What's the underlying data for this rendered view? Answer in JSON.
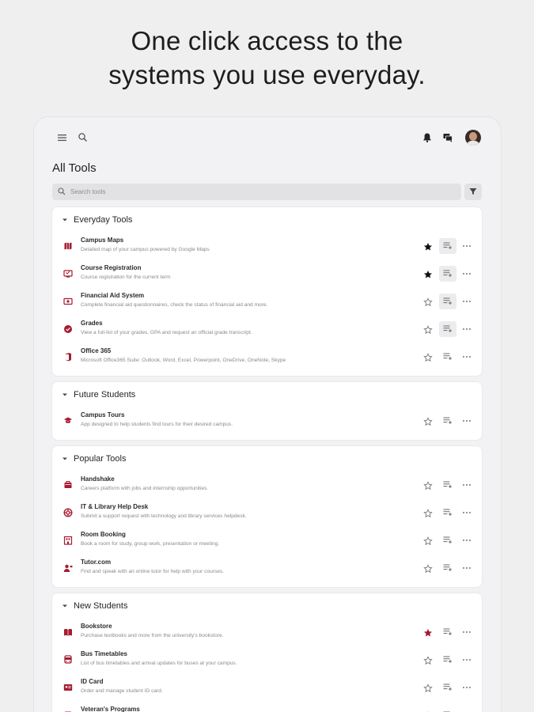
{
  "headline": {
    "line1": "One click access to the",
    "line2": "systems you use everyday."
  },
  "topbar": {
    "icons": [
      "menu-icon",
      "search-icon",
      "notification-bell-icon",
      "chat-icon",
      "avatar"
    ]
  },
  "page": {
    "title": "All Tools",
    "search_placeholder": "Search tools"
  },
  "colors": {
    "accent": "#a51c30",
    "star_filled": "#111111",
    "star_filled_accent": "#a51c30",
    "muted": "#8a8a8a"
  },
  "sections": [
    {
      "title": "Everyday Tools",
      "items": [
        {
          "name": "Campus Maps",
          "desc": "Detailed map of your campus powered by Google Maps",
          "icon": "map-icon",
          "starred": true,
          "star_color": "#111111",
          "quick_access": true
        },
        {
          "name": "Course Registration",
          "desc": "Course registration for the current term",
          "icon": "course-icon",
          "starred": true,
          "star_color": "#111111",
          "quick_access": true
        },
        {
          "name": "Financial Aid System",
          "desc": "Complete financial aid questionnaires, check the status of financial aid and more.",
          "icon": "financial-aid-icon",
          "starred": false,
          "quick_access": true
        },
        {
          "name": "Grades",
          "desc": "View a full-list of your grades, GPA and request an official grade transcript.",
          "icon": "grades-icon",
          "starred": false,
          "quick_access": true
        },
        {
          "name": "Office 365",
          "desc": "Microsoft Office365 Suite: Outlook, Word, Excel, Powerpoint, OneDrive, OneNote, Skype",
          "icon": "office-icon",
          "starred": false,
          "quick_access": false
        }
      ]
    },
    {
      "title": "Future Students",
      "items": [
        {
          "name": "Campus Tours",
          "desc": "App designed to help students find tours for their desired campus.",
          "icon": "tours-icon",
          "starred": false,
          "quick_access": false
        }
      ]
    },
    {
      "title": "Popular Tools",
      "items": [
        {
          "name": "Handshake",
          "desc": "Careers platform with jobs and internship opportunities.",
          "icon": "handshake-icon",
          "starred": false,
          "quick_access": false
        },
        {
          "name": "IT & Library Help Desk",
          "desc": "Submit a support request with technology and library services helpdesk.",
          "icon": "helpdesk-icon",
          "starred": false,
          "quick_access": false
        },
        {
          "name": "Room Booking",
          "desc": "Book a room for study, group work, presentation or meeting.",
          "icon": "room-icon",
          "starred": false,
          "quick_access": false
        },
        {
          "name": "Tutor.com",
          "desc": "Find and speak with an online tutor for help with your courses.",
          "icon": "tutor-icon",
          "starred": false,
          "quick_access": false
        }
      ]
    },
    {
      "title": "New Students",
      "items": [
        {
          "name": "Bookstore",
          "desc": "Purchase textbooks and more from the university's bookstore.",
          "icon": "bookstore-icon",
          "starred": true,
          "star_color": "#a51c30",
          "quick_access": false
        },
        {
          "name": "Bus Timetables",
          "desc": "List of bus timetables and arrival updates for buses at your campus.",
          "icon": "bus-icon",
          "starred": false,
          "quick_access": false
        },
        {
          "name": "ID Card",
          "desc": "Order and manage student ID card.",
          "icon": "id-card-icon",
          "starred": false,
          "quick_access": false
        },
        {
          "name": "Veteran's Programs",
          "desc": "",
          "icon": "veteran-icon",
          "starred": false,
          "quick_access": false
        }
      ]
    }
  ]
}
